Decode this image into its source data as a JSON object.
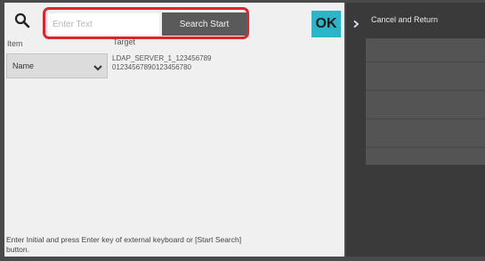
{
  "search": {
    "placeholder": "Enter Text",
    "value": "",
    "button_label": "Search Start"
  },
  "ok_button": {
    "label": "OK"
  },
  "columns": {
    "item": "Item",
    "target": "Target"
  },
  "item_select": {
    "selected": "Name"
  },
  "target_value": {
    "line1": "LDAP_SERVER_1_123456789",
    "line2": "01234567890123456780"
  },
  "help_text": "Enter Initial and press Enter key of external keyboard or [Start Search] button.",
  "right_panel": {
    "cancel_label": "Cancel and Return"
  },
  "colors": {
    "highlight": "#e0242b",
    "ok_accent": "#2ab5c9",
    "search_button": "#5a5a5a",
    "right_panel": "#3a3a3a",
    "right_area": "#545454"
  },
  "icons": {
    "search": "search-icon",
    "select_chevron": "chevron-down-icon",
    "cancel_chevron": "chevron-right-icon"
  }
}
